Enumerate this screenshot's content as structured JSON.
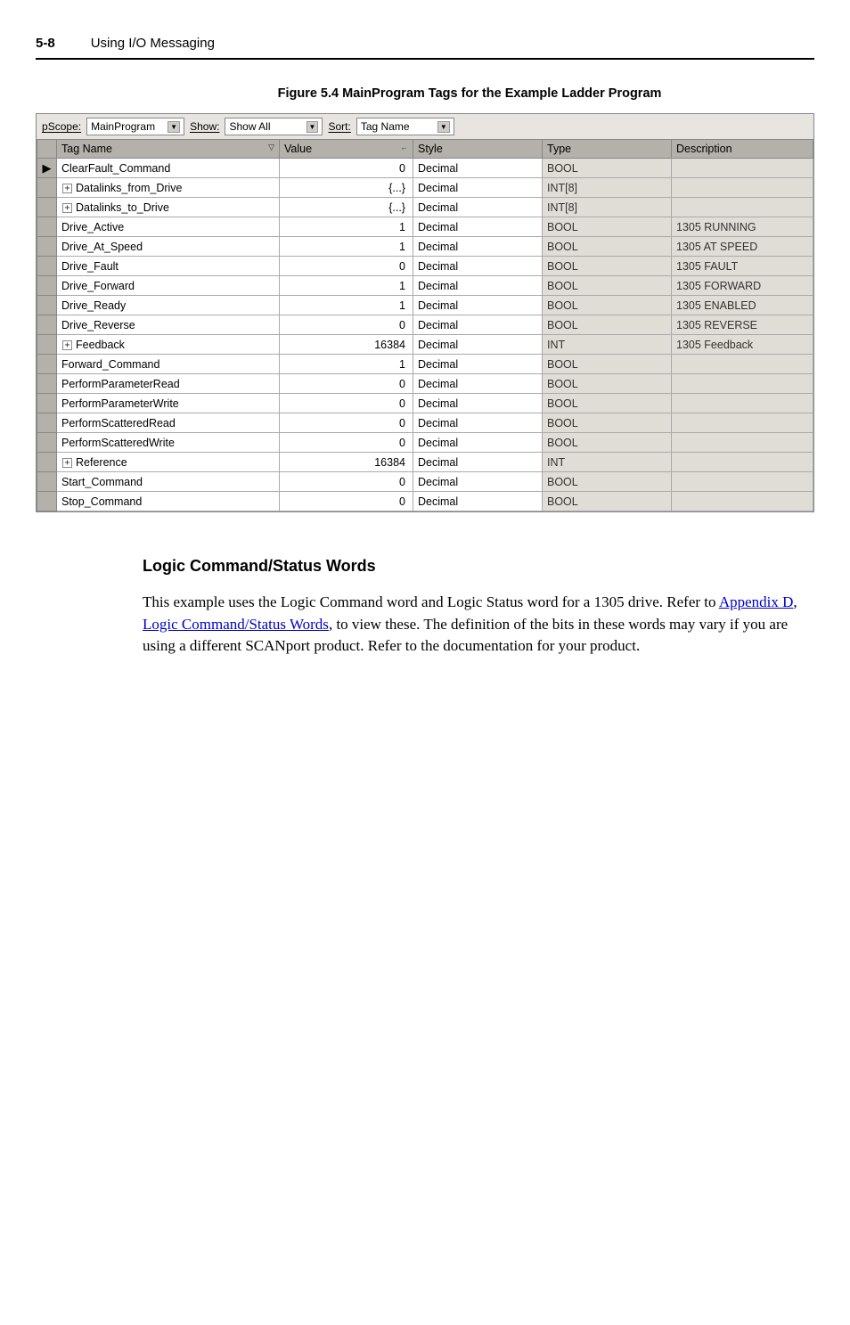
{
  "header": {
    "pageNumber": "5-8",
    "title": "Using I/O Messaging"
  },
  "figure": {
    "caption": "Figure 5.4   MainProgram Tags for the Example Ladder Program"
  },
  "tagEditor": {
    "labels": {
      "scope": "Scope:",
      "show": "Show:",
      "sort": "Sort:"
    },
    "dropdowns": {
      "scope": "MainProgram",
      "show": "Show All",
      "sort": "Tag Name"
    },
    "columns": {
      "tagName": "Tag Name",
      "value": "Value",
      "style": "Style",
      "type": "Type",
      "description": "Description"
    },
    "rows": [
      {
        "selector": "▶",
        "expand": "",
        "indent": true,
        "name": "ClearFault_Command",
        "value": "0",
        "style": "Decimal",
        "type": "BOOL",
        "description": ""
      },
      {
        "selector": "",
        "expand": "+",
        "indent": false,
        "name": "Datalinks_from_Drive",
        "value": "{...}",
        "style": "Decimal",
        "type": "INT[8]",
        "description": ""
      },
      {
        "selector": "",
        "expand": "+",
        "indent": false,
        "name": "Datalinks_to_Drive",
        "value": "{...}",
        "style": "Decimal",
        "type": "INT[8]",
        "description": ""
      },
      {
        "selector": "",
        "expand": "",
        "indent": true,
        "name": "Drive_Active",
        "value": "1",
        "style": "Decimal",
        "type": "BOOL",
        "description": "1305 RUNNING"
      },
      {
        "selector": "",
        "expand": "",
        "indent": true,
        "name": "Drive_At_Speed",
        "value": "1",
        "style": "Decimal",
        "type": "BOOL",
        "description": "1305 AT SPEED"
      },
      {
        "selector": "",
        "expand": "",
        "indent": true,
        "name": "Drive_Fault",
        "value": "0",
        "style": "Decimal",
        "type": "BOOL",
        "description": "1305 FAULT"
      },
      {
        "selector": "",
        "expand": "",
        "indent": true,
        "name": "Drive_Forward",
        "value": "1",
        "style": "Decimal",
        "type": "BOOL",
        "description": "1305 FORWARD"
      },
      {
        "selector": "",
        "expand": "",
        "indent": true,
        "name": "Drive_Ready",
        "value": "1",
        "style": "Decimal",
        "type": "BOOL",
        "description": "1305 ENABLED"
      },
      {
        "selector": "",
        "expand": "",
        "indent": true,
        "name": "Drive_Reverse",
        "value": "0",
        "style": "Decimal",
        "type": "BOOL",
        "description": "1305 REVERSE"
      },
      {
        "selector": "",
        "expand": "+",
        "indent": false,
        "name": "Feedback",
        "value": "16384",
        "style": "Decimal",
        "type": "INT",
        "description": "1305 Feedback"
      },
      {
        "selector": "",
        "expand": "",
        "indent": true,
        "name": "Forward_Command",
        "value": "1",
        "style": "Decimal",
        "type": "BOOL",
        "description": ""
      },
      {
        "selector": "",
        "expand": "",
        "indent": true,
        "name": "PerformParameterRead",
        "value": "0",
        "style": "Decimal",
        "type": "BOOL",
        "description": ""
      },
      {
        "selector": "",
        "expand": "",
        "indent": true,
        "name": "PerformParameterWrite",
        "value": "0",
        "style": "Decimal",
        "type": "BOOL",
        "description": ""
      },
      {
        "selector": "",
        "expand": "",
        "indent": true,
        "name": "PerformScatteredRead",
        "value": "0",
        "style": "Decimal",
        "type": "BOOL",
        "description": ""
      },
      {
        "selector": "",
        "expand": "",
        "indent": true,
        "name": "PerformScatteredWrite",
        "value": "0",
        "style": "Decimal",
        "type": "BOOL",
        "description": ""
      },
      {
        "selector": "",
        "expand": "+",
        "indent": false,
        "name": "Reference",
        "value": "16384",
        "style": "Decimal",
        "type": "INT",
        "description": ""
      },
      {
        "selector": "",
        "expand": "",
        "indent": true,
        "name": "Start_Command",
        "value": "0",
        "style": "Decimal",
        "type": "BOOL",
        "description": ""
      },
      {
        "selector": "",
        "expand": "",
        "indent": true,
        "name": "Stop_Command",
        "value": "0",
        "style": "Decimal",
        "type": "BOOL",
        "description": ""
      }
    ]
  },
  "section": {
    "title": "Logic Command/Status Words",
    "body": {
      "p1a": "This example uses the Logic Command word and Logic Status word for a 1305 drive. Refer to ",
      "link1": "Appendix D",
      "comma": ", ",
      "link2": "Logic Command/Status Words",
      "p1b": ", to view these. The definition of the bits in these words may vary if you are using a different SCANport product. Refer to the documentation for your product."
    }
  }
}
